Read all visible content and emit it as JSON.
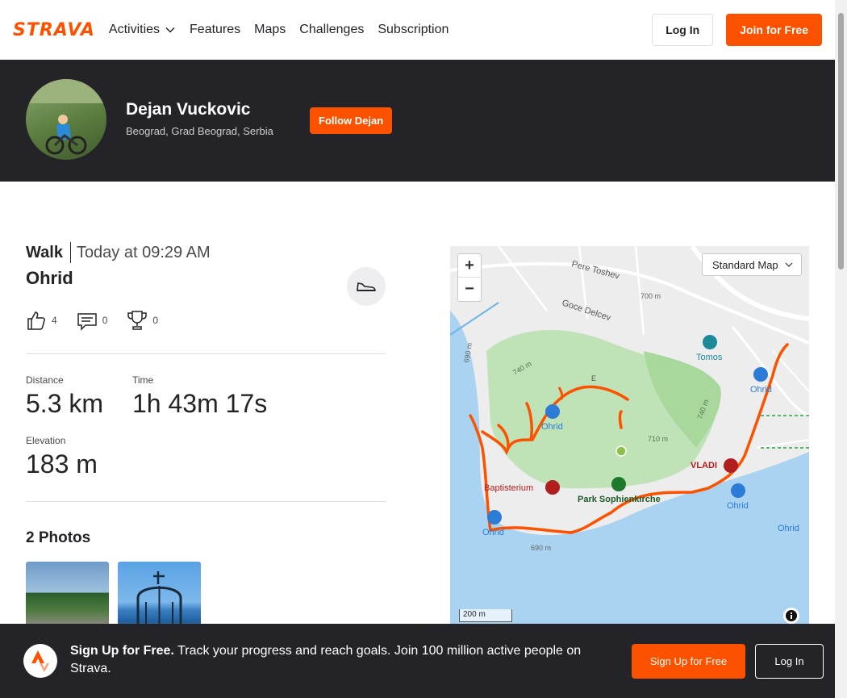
{
  "nav": {
    "logo": "STRAVA",
    "items": [
      "Activities",
      "Features",
      "Maps",
      "Challenges",
      "Subscription"
    ],
    "login": "Log In",
    "join": "Join for Free"
  },
  "athlete": {
    "name": "Dejan Vuckovic",
    "location": "Beograd, Grad Beograd, Serbia",
    "follow": "Follow Dejan"
  },
  "activity": {
    "type": "Walk",
    "time": "Today at 09:29 AM",
    "title": "Ohrid",
    "kudos": "4",
    "comments": "0",
    "achievements": "0",
    "stats": {
      "distance_label": "Distance",
      "distance_value": "5.3 km",
      "time_label": "Time",
      "time_value": "1h 43m 17s",
      "elevation_label": "Elevation",
      "elevation_value": "183 m"
    },
    "photos_title": "2 Photos"
  },
  "map": {
    "style": "Standard Map",
    "scale": "200 m",
    "zoom_in": "+",
    "zoom_out": "−",
    "labels": {
      "pere": "Pere Toshev",
      "goce": "Goce Delcev",
      "m700": "700 m",
      "m690a": "690 m",
      "m690b": "690 m",
      "m740": "740 m",
      "m710": "710 m",
      "m740b": "740 m",
      "tomos": "Tomos",
      "ohrid1": "Ohrid",
      "ohrid2": "Ohrid",
      "ohrid3": "Ohrid",
      "ohrid4": "Ohrid",
      "ohrid5": "Ohrid",
      "vladi": "VLADI",
      "baptisterium": "Baptisterium",
      "park": "Park Sophienkirche",
      "e": "E"
    },
    "route_color": "#fc5200"
  },
  "banner": {
    "bold": "Sign Up for Free.",
    "text": " Track your progress and reach goals. Join 100 million active people on Strava.",
    "signup": "Sign Up for Free",
    "login": "Log In"
  }
}
